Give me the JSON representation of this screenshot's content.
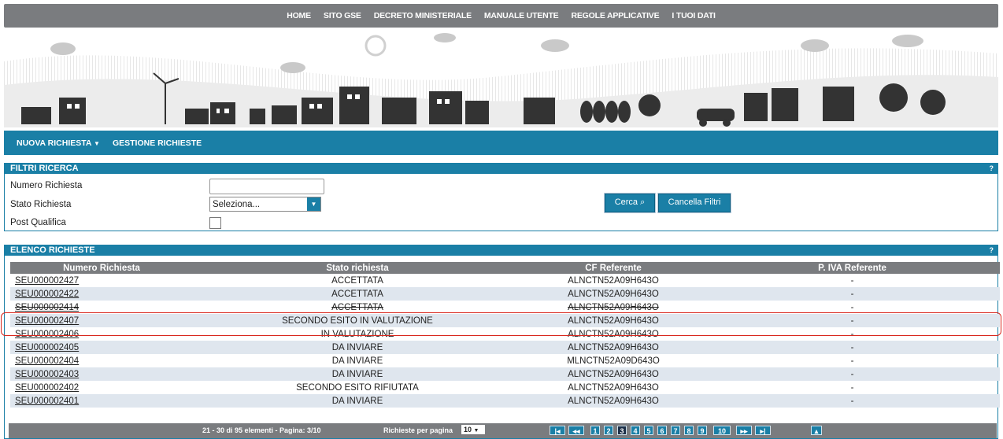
{
  "topnav": [
    "HOME",
    "SITO GSE",
    "DECRETO MINISTERIALE",
    "MANUALE UTENTE",
    "REGOLE APPLICATIVE",
    "I TUOI DATI"
  ],
  "mainnav": {
    "new_request": "NUOVA RICHIESTA",
    "manage": "GESTIONE RICHIESTE"
  },
  "filters": {
    "title": "FILTRI RICERCA",
    "help": "?",
    "number_label": "Numero Richiesta",
    "number_value": "",
    "status_label": "Stato Richiesta",
    "status_value": "Seleziona...",
    "post_label": "Post Qualifica",
    "search_button": "Cerca",
    "clear_button": "Cancella Filtri"
  },
  "list": {
    "title": "ELENCO RICHIESTE",
    "help": "?",
    "columns": [
      "Numero Richiesta",
      "Stato richiesta",
      "CF Referente",
      "P. IVA Referente"
    ],
    "rows": [
      [
        "SEU000002427",
        "ACCETTATA",
        "ALNCTN52A09H643O",
        "-"
      ],
      [
        "SEU000002422",
        "ACCETTATA",
        "ALNCTN52A09H643O",
        "-"
      ],
      [
        "SEU000002414",
        "ACCETTATA",
        "ALNCTN52A09H643O",
        "-"
      ],
      [
        "SEU000002407",
        "SECONDO ESITO IN VALUTAZIONE",
        "ALNCTN52A09H643O",
        "-"
      ],
      [
        "SEU000002406",
        "IN VALUTAZIONE",
        "ALNCTN52A09H643O",
        "-"
      ],
      [
        "SEU000002405",
        "DA INVIARE",
        "ALNCTN52A09H643O",
        "-"
      ],
      [
        "SEU000002404",
        "DA INVIARE",
        "MLNCTN52A09D643O",
        "-"
      ],
      [
        "SEU000002403",
        "DA INVIARE",
        "ALNCTN52A09H643O",
        "-"
      ],
      [
        "SEU000002402",
        "SECONDO ESITO RIFIUTATA",
        "ALNCTN52A09H643O",
        "-"
      ],
      [
        "SEU000002401",
        "DA INVIARE",
        "ALNCTN52A09H643O",
        "-"
      ]
    ]
  },
  "pager": {
    "info": "21 - 30 di 95 elementi - Pagina: 3/10",
    "per_page_label": "Richieste per pagina",
    "per_page_value": "10",
    "pages": [
      "1",
      "2",
      "3",
      "4",
      "5",
      "6",
      "7",
      "8",
      "9",
      "10"
    ],
    "current": "3"
  }
}
